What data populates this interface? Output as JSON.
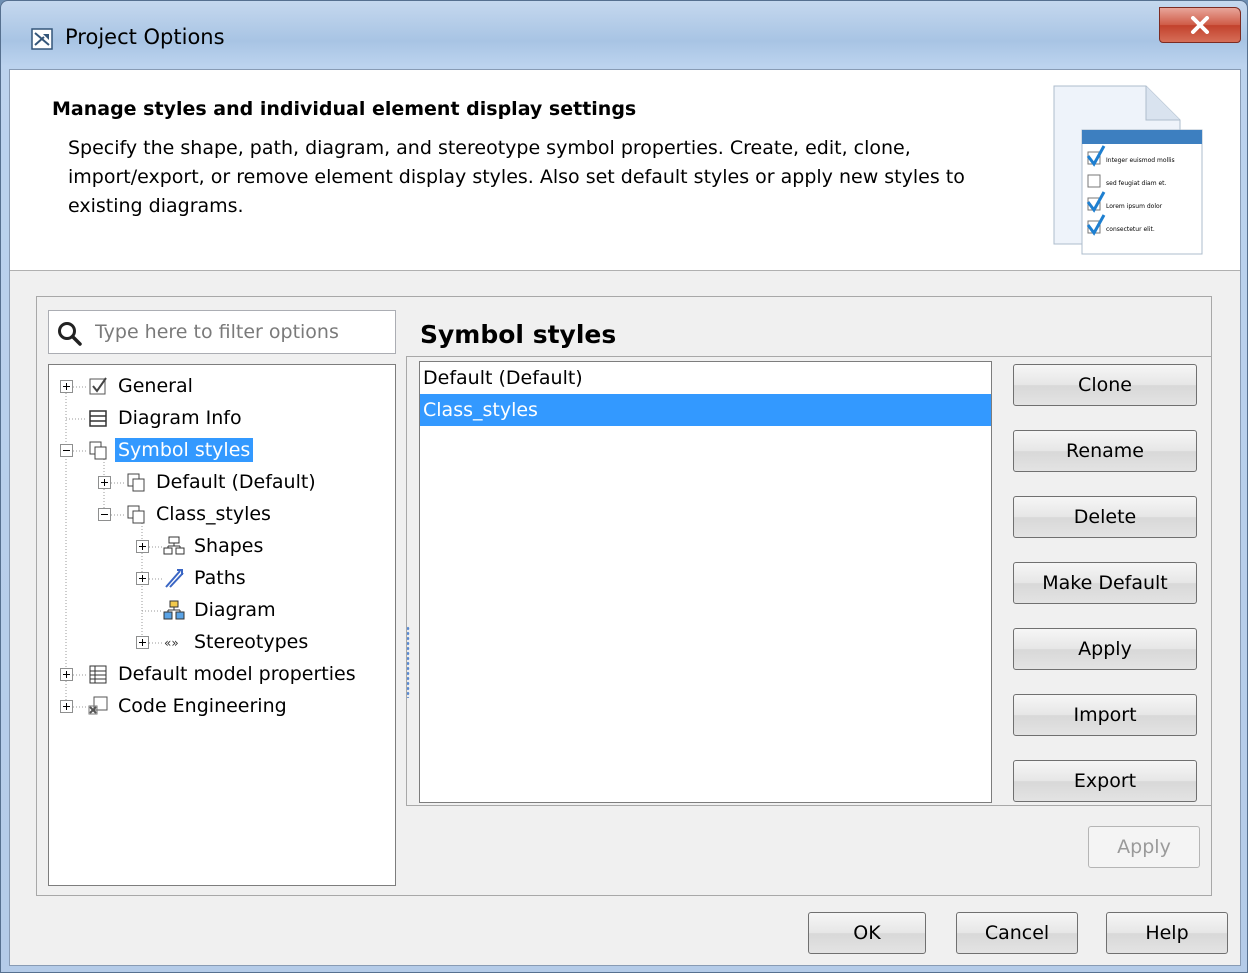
{
  "window": {
    "title": "Project Options"
  },
  "header": {
    "title": "Manage styles and individual element display settings",
    "description": "Specify the shape, path, diagram, and stereotype symbol properties. Create, edit, clone, import/export, or remove element display styles. Also set default styles or apply new styles to existing diagrams.",
    "graphic_items": [
      "Integer euismod mollis",
      "sed feugiat diam et.",
      "Lorem ipsum dolor",
      "consectetur elit."
    ]
  },
  "filter": {
    "placeholder": "Type here to filter options",
    "value": ""
  },
  "tree": [
    {
      "label": "General",
      "icon": "checkbox-icon",
      "level": 0
    },
    {
      "label": "Diagram Info",
      "icon": "table-icon",
      "level": 0
    },
    {
      "label": "Symbol styles",
      "icon": "styles-icon",
      "level": 0,
      "selected": true
    },
    {
      "label": "Default (Default)",
      "icon": "styles-icon",
      "level": 1
    },
    {
      "label": "Class_styles",
      "icon": "styles-icon",
      "level": 1
    },
    {
      "label": "Shapes",
      "icon": "shapes-icon",
      "level": 2
    },
    {
      "label": "Paths",
      "icon": "paths-icon",
      "level": 2
    },
    {
      "label": "Diagram",
      "icon": "diagram-icon",
      "level": 2
    },
    {
      "label": "Stereotypes",
      "icon": "stereotype-icon",
      "level": 2
    },
    {
      "label": "Default model properties",
      "icon": "properties-icon",
      "level": 0
    },
    {
      "label": "Code Engineering",
      "icon": "code-engineering-icon",
      "level": 0
    }
  ],
  "main": {
    "title": "Symbol styles",
    "styles": [
      "Default (Default)",
      "Class_styles"
    ],
    "selected_style": "Class_styles",
    "buttons": {
      "clone": "Clone",
      "rename": "Rename",
      "delete": "Delete",
      "make_default": "Make Default",
      "apply": "Apply",
      "import": "Import",
      "export": "Export"
    },
    "apply_panel": "Apply"
  },
  "footer": {
    "ok": "OK",
    "cancel": "Cancel",
    "help": "Help"
  },
  "colors": {
    "selection": "#3399ff",
    "close_button": "#c2412c"
  }
}
